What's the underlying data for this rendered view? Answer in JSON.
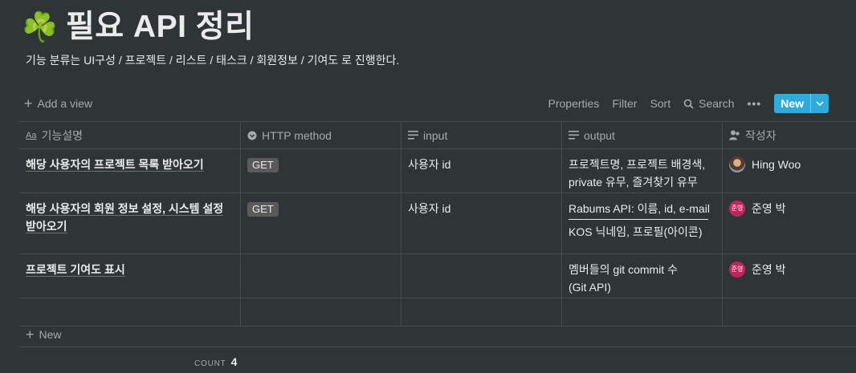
{
  "page": {
    "icon": "☘️",
    "title": "필요 API 정리",
    "description": "기능 분류는 UI구성 / 프로젝트 / 리스트 / 태스크 / 회원정보 / 기여도 로 진행한다."
  },
  "toolbar": {
    "add_view": "Add a view",
    "properties": "Properties",
    "filter": "Filter",
    "sort": "Sort",
    "search": "Search",
    "more": "•••",
    "new": "New"
  },
  "columns": [
    {
      "label": "기능설명",
      "icon": "title-icon"
    },
    {
      "label": "HTTP method",
      "icon": "select-icon"
    },
    {
      "label": "input",
      "icon": "text-icon"
    },
    {
      "label": "output",
      "icon": "text-icon"
    },
    {
      "label": "작성자",
      "icon": "person-icon"
    }
  ],
  "rows": [
    {
      "name": "해당 사용자의 프로젝트 목록 받아오기",
      "method": "GET",
      "input": "사용자 id",
      "output": [
        "프로젝트명, 프로젝트 배경색,",
        "private 유무, 즐겨찾기 유무"
      ],
      "author": {
        "name": "Hing Woo",
        "avatar": "photo"
      }
    },
    {
      "name": "해당 사용자의 회원 정보 설정, 시스템 설정 받아오기",
      "method": "GET",
      "input": "사용자 id",
      "output": [
        "Rabums API: 이름, id, e-mail",
        "KOS 닉네임, 프로필(아이콘)"
      ],
      "author": {
        "name": "준영 박",
        "avatar": "준영"
      }
    },
    {
      "name": "프로젝트 기여도 표시",
      "method": "",
      "input": "",
      "output": [
        "멤버들의 git commit 수",
        "(Git API)"
      ],
      "author": {
        "name": "준영 박",
        "avatar": "준영"
      }
    }
  ],
  "new_row": "New",
  "count": {
    "label": "COUNT",
    "value": "4"
  },
  "colors": {
    "background": "#2f3437",
    "accent": "#2eaadc",
    "avatar_red": "#c0245f",
    "tag": "#5a5a5a"
  }
}
